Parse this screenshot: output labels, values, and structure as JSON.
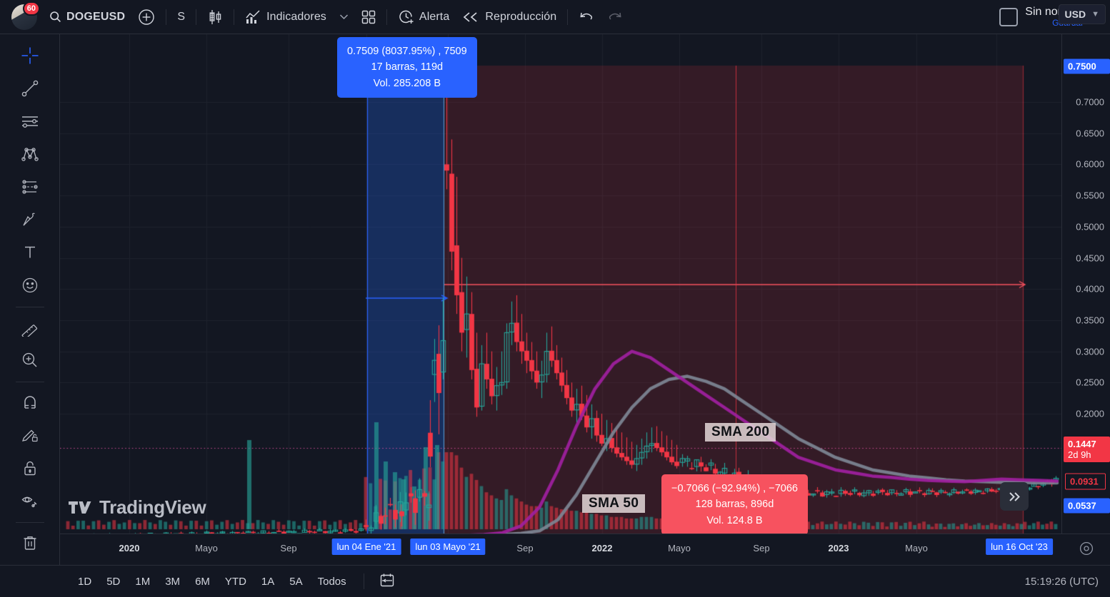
{
  "app": {
    "name": "TradingView"
  },
  "topbar": {
    "avatar_badge": "60",
    "search_icon": "search-icon",
    "symbol": "DOGEUSD",
    "add_symbol_icon": "plus-circle-icon",
    "interval": "S",
    "chart_type_icon": "candlestick-icon",
    "indicators_icon": "indicators-chart-icon",
    "indicators_label": "Indicadores",
    "indicators_caret": "chevron-down-icon",
    "layouts_icon": "grid-layouts-icon",
    "alert_icon": "alert-clock-icon",
    "alert_label": "Alerta",
    "replay_icon": "replay-rewind-icon",
    "replay_label": "Reproducción",
    "undo_icon": "undo-arrow-icon",
    "redo_icon": "redo-arrow-icon",
    "layout_box_icon": "layout-square-icon",
    "chart_title": "Sin nombre",
    "save_label": "Guardar",
    "title_caret": "chevron-down-icon"
  },
  "sidebar": {
    "items": [
      {
        "name": "cross-cursor-icon",
        "label": "Cursor en cruz",
        "active": true
      },
      {
        "name": "trend-line-icon",
        "label": "Línea de tendencia",
        "active": false
      },
      {
        "name": "horizontal-lines-icon",
        "label": "Líneas horizontales",
        "active": false
      },
      {
        "name": "elliott-wave-icon",
        "label": "Patrones",
        "active": false
      },
      {
        "name": "fib-projection-icon",
        "label": "Herramientas de predicción",
        "active": false
      },
      {
        "name": "brush-icon",
        "label": "Pincel",
        "active": false
      },
      {
        "name": "text-tool-icon",
        "label": "Texto",
        "active": false
      },
      {
        "name": "emoji-icon",
        "label": "Emoji / Notas",
        "active": false
      },
      {
        "name": "measure-ruler-icon",
        "label": "Medir",
        "active": false
      },
      {
        "name": "zoom-in-icon",
        "label": "Acercar",
        "active": false
      },
      {
        "name": "magnet-icon",
        "label": "Modo imán",
        "active": false
      },
      {
        "name": "stay-in-drawing-mode-icon",
        "label": "Permanecer en modo dibujo",
        "active": false
      },
      {
        "name": "lock-drawings-icon",
        "label": "Bloquear todos los dibujos",
        "active": false
      },
      {
        "name": "hide-drawings-icon",
        "label": "Ocultar todos los dibujos",
        "active": false
      },
      {
        "name": "trash-icon",
        "label": "Eliminar dibujos",
        "active": false
      }
    ]
  },
  "price_scale": {
    "currency": "USD",
    "currency_caret": "chevron-down-icon",
    "ticks": [
      "0.7000",
      "0.6500",
      "0.6000",
      "0.5500",
      "0.5000",
      "0.4500",
      "0.4000",
      "0.3500",
      "0.3000",
      "0.2500",
      "0.2000"
    ],
    "badges": [
      {
        "name": "measurement-top-price-badge",
        "text": "0.7500",
        "bg": "#2962ff",
        "fg": "#ffffff"
      },
      {
        "name": "last-high-price-badge",
        "text": "0.1447",
        "sub": "2d 9h",
        "bg": "#f23645",
        "fg": "#ffffff"
      },
      {
        "name": "current-price-badge",
        "text": "0.0931",
        "bg": "#131722",
        "fg": "#f23645"
      },
      {
        "name": "measurement-bottom-price-badge",
        "text": "0.0537",
        "bg": "#2962ff",
        "fg": "#ffffff"
      }
    ]
  },
  "time_scale": {
    "ticks": [
      {
        "label": "2020",
        "bold": true
      },
      {
        "label": "Mayo",
        "bold": false
      },
      {
        "label": "Sep",
        "bold": false
      },
      {
        "label": "Sep",
        "bold": false
      },
      {
        "label": "2022",
        "bold": true
      },
      {
        "label": "Mayo",
        "bold": false
      },
      {
        "label": "Sep",
        "bold": false
      },
      {
        "label": "2023",
        "bold": true
      },
      {
        "label": "Mayo",
        "bold": false
      }
    ],
    "badges": [
      {
        "name": "measurement-start-date-badge",
        "text": "lun 04 Ene '21"
      },
      {
        "name": "measurement-end-date-badge",
        "text": "lun 03 Mayo '21"
      },
      {
        "name": "current-date-badge",
        "text": "lun 16 Oct '23"
      }
    ],
    "settings_icon": "gear-icon"
  },
  "measurements": [
    {
      "name": "bullish-measurement-tooltip",
      "color": "#2962ff",
      "line1": "0.7509 (8037.95%) , 7509",
      "line2": "17 barras, 119d",
      "line3": "Vol. 285.208 B"
    },
    {
      "name": "bearish-measurement-tooltip",
      "color": "#f7525f",
      "line1": "−0.7066 (−92.94%) , −7066",
      "line2": "128 barras, 896d",
      "line3": "Vol. 124.8 B"
    }
  ],
  "indicator_labels": [
    {
      "name": "sma-200-label",
      "text": "SMA 200",
      "color": "#7d8694"
    },
    {
      "name": "sma-50-label",
      "text": "SMA 50",
      "color": "#a020a0"
    }
  ],
  "watermark": {
    "text": "TradingView",
    "icon": "tradingview-logo-icon"
  },
  "scroll_to_realtime": {
    "icon": "double-chevron-right-icon"
  },
  "bottombar": {
    "timeframes": [
      "1D",
      "5D",
      "1M",
      "3M",
      "6M",
      "YTD",
      "1A",
      "5A",
      "Todos"
    ],
    "calendar_icon": "calendar-range-icon",
    "clock": "15:19:26 (UTC)"
  },
  "chart_data": {
    "type": "candlestick",
    "symbol": "DOGEUSD",
    "title": "DOGEUSD",
    "ylabel": "USD",
    "ylim": [
      0.0,
      0.78
    ],
    "xlim": [
      "2019-11",
      "2023-12"
    ],
    "grid": true,
    "price_ticks": [
      0.7,
      0.65,
      0.6,
      0.55,
      0.5,
      0.45,
      0.4,
      0.35,
      0.3,
      0.25,
      0.2
    ],
    "series": [
      {
        "name": "SMA 50",
        "type": "line",
        "color": "#a020a0",
        "values": [
          0.004,
          0.004,
          0.005,
          0.006,
          0.009,
          0.02,
          0.05,
          0.11,
          0.18,
          0.24,
          0.28,
          0.3,
          0.29,
          0.27,
          0.25,
          0.23,
          0.21,
          0.19,
          0.17,
          0.15,
          0.13,
          0.12,
          0.11,
          0.105,
          0.1,
          0.098,
          0.095,
          0.093,
          0.092,
          0.091,
          0.093,
          0.095,
          0.094,
          0.093,
          0.092
        ]
      },
      {
        "name": "SMA 200",
        "type": "line",
        "color": "#7d8694",
        "values": [
          0.003,
          0.003,
          0.004,
          0.005,
          0.006,
          0.008,
          0.012,
          0.03,
          0.07,
          0.12,
          0.17,
          0.21,
          0.24,
          0.255,
          0.26,
          0.252,
          0.24,
          0.22,
          0.2,
          0.18,
          0.16,
          0.145,
          0.13,
          0.12,
          0.11,
          0.105,
          0.1,
          0.097,
          0.094,
          0.092,
          0.091,
          0.09,
          0.09,
          0.089,
          0.089
        ]
      }
    ],
    "annotations": [
      {
        "text": "0.7509 (8037.95%) , 7509 / 17 barras, 119d / Vol. 285.208 B",
        "type": "measurement-bullish"
      },
      {
        "text": "−0.7066 (−92.94%) , −7066 / 128 barras, 896d / Vol. 124.8 B",
        "type": "measurement-bearish"
      }
    ],
    "key_levels": {
      "all_time_high": 0.7509,
      "last_price": 0.0931,
      "measurement_high": 0.1447,
      "measurement_low": 0.0537
    }
  }
}
